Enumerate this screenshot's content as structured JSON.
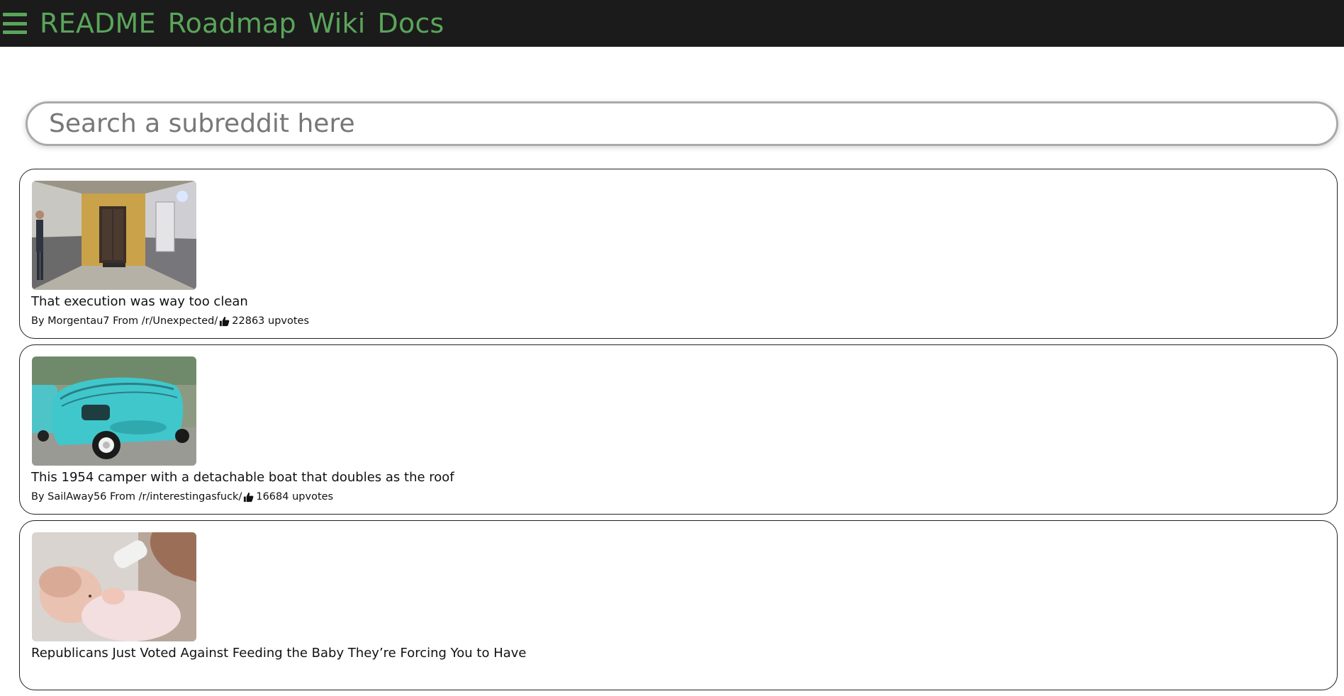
{
  "nav": {
    "menu_icon": "hamburger-icon",
    "links": [
      "README",
      "Roadmap",
      "Wiki",
      "Docs"
    ]
  },
  "search": {
    "placeholder": "Search a subreddit here",
    "value": ""
  },
  "posts": [
    {
      "title": "That execution was way too clean",
      "by_label": "By",
      "author": "Morgentau7",
      "from_label": "From",
      "subreddit": "/r/Unexpected/",
      "upvotes": "22863",
      "upvotes_label": "upvotes",
      "thumbnail": "hallway-photo"
    },
    {
      "title": "This 1954 camper with a detachable boat that doubles as the roof",
      "by_label": "By",
      "author": "SailAway56",
      "from_label": "From",
      "subreddit": "/r/interestingasfuck/",
      "upvotes": "16684",
      "upvotes_label": "upvotes",
      "thumbnail": "turquoise-camper-photo"
    },
    {
      "title": "Republicans Just Voted Against Feeding the Baby They’re Forcing You to Have",
      "by_label": "By",
      "author": "",
      "from_label": "",
      "subreddit": "",
      "upvotes": "",
      "upvotes_label": "",
      "thumbnail": "baby-bottle-photo"
    }
  ],
  "colors": {
    "topbar_bg": "#1b1b1b",
    "nav_green": "#5aa55a",
    "card_border": "#222222"
  }
}
